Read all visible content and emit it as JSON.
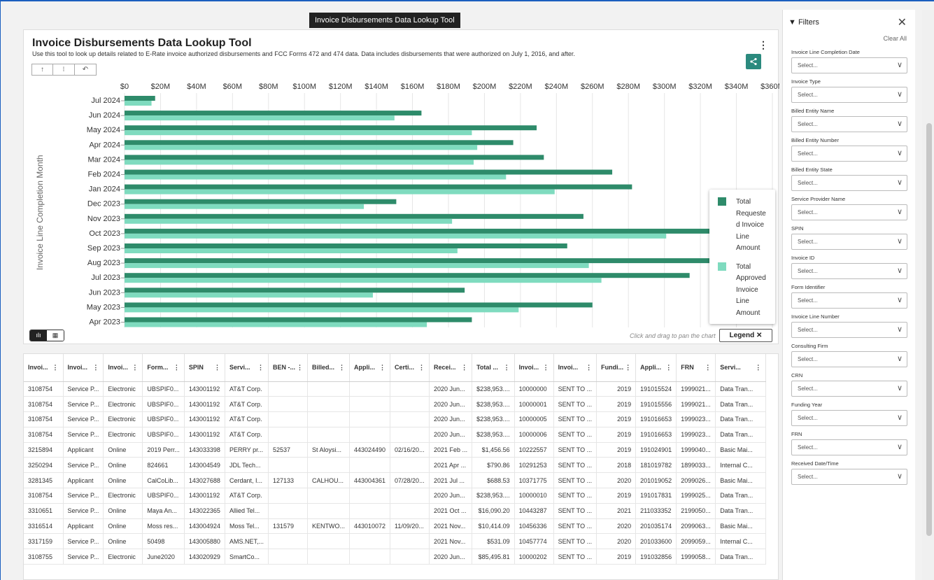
{
  "tooltip": "Invoice Disbursements Data Lookup Tool",
  "card": {
    "title": "Invoice Disbursements Data Lookup Tool",
    "subtitle": "Use this tool to look up details related to E-Rate invoice authorized disbursements and FCC Forms 472 and 474 data. Data includes disbursements that were authorized on July 1, 2016, and after.",
    "kebab": "⋮",
    "share_icon": "share-icon",
    "toolbar": [
      "↑",
      "⁝",
      "↶"
    ],
    "view_buttons": [
      "ılı",
      "▦"
    ],
    "pan_hint": "Click and drag to pan the chart",
    "legend_button": "Legend  ✕"
  },
  "chart_data": {
    "type": "bar",
    "orientation": "horizontal",
    "ylabel": "Invoice Line Completion Month",
    "x_ticks": [
      "$0",
      "$20M",
      "$40M",
      "$60M",
      "$80M",
      "$100M",
      "$120M",
      "$140M",
      "$160M",
      "$180M",
      "$200M",
      "$220M",
      "$240M",
      "$260M",
      "$280M",
      "$300M",
      "$320M",
      "$340M",
      "$360M"
    ],
    "xlim": [
      0,
      360
    ],
    "grid": true,
    "legend_position": "right",
    "categories": [
      "Jul 2024",
      "Jun 2024",
      "May 2024",
      "Apr 2024",
      "Mar 2024",
      "Feb 2024",
      "Jan 2024",
      "Dec 2023",
      "Nov 2023",
      "Oct 2023",
      "Sep 2023",
      "Aug 2023",
      "Jul 2023",
      "Jun 2023",
      "May 2023",
      "Apr 2023"
    ],
    "series": [
      {
        "name": "Total Requested Invoice Line Amount",
        "color": "#2e8b6a",
        "values": [
          17,
          165,
          229,
          216,
          233,
          271,
          282,
          151,
          255,
          371,
          246,
          371,
          314,
          189,
          260,
          193
        ]
      },
      {
        "name": "Total Approved Invoice Line Amount",
        "color": "#7fdbbf",
        "values": [
          15,
          150,
          193,
          196,
          194,
          212,
          239,
          133,
          182,
          301,
          185,
          258,
          265,
          138,
          219,
          168
        ]
      }
    ]
  },
  "table": {
    "columns": [
      "Invoi...",
      "Invoi...",
      "Invoi...",
      "Form...",
      "SPIN",
      "Servi...",
      "BEN -...",
      "Billed...",
      "Appli...",
      "Certi...",
      "Recei...",
      "Total ...",
      "Invoi...",
      "Invoi...",
      "Fundi...",
      "Appli...",
      "FRN",
      "Servi..."
    ],
    "menu_glyph": "⋮",
    "rows": [
      [
        "3108754",
        "Service P...",
        "Electronic",
        "UBSPIF0...",
        "143001192",
        "AT&T Corp.",
        "",
        "",
        "",
        "",
        "2020 Jun...",
        "$238,953....",
        "10000000",
        "SENT TO ...",
        "2019",
        "191015524",
        "1999021...",
        "Data Tran..."
      ],
      [
        "3108754",
        "Service P...",
        "Electronic",
        "UBSPIF0...",
        "143001192",
        "AT&T Corp.",
        "",
        "",
        "",
        "",
        "2020 Jun...",
        "$238,953....",
        "10000001",
        "SENT TO ...",
        "2019",
        "191015556",
        "1999021...",
        "Data Tran..."
      ],
      [
        "3108754",
        "Service P...",
        "Electronic",
        "UBSPIF0...",
        "143001192",
        "AT&T Corp.",
        "",
        "",
        "",
        "",
        "2020 Jun...",
        "$238,953....",
        "10000005",
        "SENT TO ...",
        "2019",
        "191016653",
        "1999023...",
        "Data Tran..."
      ],
      [
        "3108754",
        "Service P...",
        "Electronic",
        "UBSPIF0...",
        "143001192",
        "AT&T Corp.",
        "",
        "",
        "",
        "",
        "2020 Jun...",
        "$238,953....",
        "10000006",
        "SENT TO ...",
        "2019",
        "191016653",
        "1999023...",
        "Data Tran..."
      ],
      [
        "3215894",
        "Applicant",
        "Online",
        "2019 Perr...",
        "143033398",
        "PERRY pr...",
        "52537",
        "St Aloysi...",
        "443024490",
        "02/16/20...",
        "2021 Feb ...",
        "$1,456.56",
        "10222557",
        "SENT TO ...",
        "2019",
        "191024901",
        "1999040...",
        "Basic Mai..."
      ],
      [
        "3250294",
        "Service P...",
        "Online",
        "824661",
        "143004549",
        "JDL Tech...",
        "",
        "",
        "",
        "",
        "2021 Apr ...",
        "$790.86",
        "10291253",
        "SENT TO ...",
        "2018",
        "181019782",
        "1899033...",
        "Internal C..."
      ],
      [
        "3281345",
        "Applicant",
        "Online",
        "CalCoLib...",
        "143027688",
        "Cerdant, I...",
        "127133",
        "CALHOU...",
        "443004361",
        "07/28/20...",
        "2021 Jul ...",
        "$688.53",
        "10371775",
        "SENT TO ...",
        "2020",
        "201019052",
        "2099026...",
        "Basic Mai..."
      ],
      [
        "3108754",
        "Service P...",
        "Electronic",
        "UBSPIF0...",
        "143001192",
        "AT&T Corp.",
        "",
        "",
        "",
        "",
        "2020 Jun...",
        "$238,953....",
        "10000010",
        "SENT TO ...",
        "2019",
        "191017831",
        "1999025...",
        "Data Tran..."
      ],
      [
        "3310651",
        "Service P...",
        "Online",
        "Maya An...",
        "143022365",
        "Allied Tel...",
        "",
        "",
        "",
        "",
        "2021 Oct ...",
        "$16,090.20",
        "10443287",
        "SENT TO ...",
        "2021",
        "211033352",
        "2199050...",
        "Data Tran..."
      ],
      [
        "3316514",
        "Applicant",
        "Online",
        "Moss res...",
        "143004924",
        "Moss Tel...",
        "131579",
        "KENTWO...",
        "443010072",
        "11/09/20...",
        "2021 Nov...",
        "$10,414.09",
        "10456336",
        "SENT TO ...",
        "2020",
        "201035174",
        "2099063...",
        "Basic Mai..."
      ],
      [
        "3317159",
        "Service P...",
        "Online",
        "50498",
        "143005880",
        "AMS.NET,...",
        "",
        "",
        "",
        "",
        "2021 Nov...",
        "$531.09",
        "10457774",
        "SENT TO ...",
        "2020",
        "201033600",
        "2099059...",
        "Internal C..."
      ],
      [
        "3108755",
        "Service P...",
        "Electronic",
        "June2020",
        "143020929",
        "SmartCo...",
        "",
        "",
        "",
        "",
        "2020 Jun...",
        "$85,495.81",
        "10000202",
        "SENT TO ...",
        "2019",
        "191032856",
        "1999058...",
        "Data Tran..."
      ]
    ]
  },
  "filters": {
    "title": "Filters",
    "filter_icon": "▼",
    "close": "✕",
    "clear_all": "Clear All",
    "placeholder": "Select...",
    "chevron": "∨",
    "items": [
      "Invoice Line Completion Date",
      "Invoice Type",
      "Billed Entity Name",
      "Billed Entity Number",
      "Billed Entity State",
      "Service Provider Name",
      "SPIN",
      "Invoice ID",
      "Form Identifier",
      "Invoice Line Number",
      "Consulting Firm",
      "CRN",
      "Funding Year",
      "FRN",
      "Received Date/Time"
    ]
  }
}
